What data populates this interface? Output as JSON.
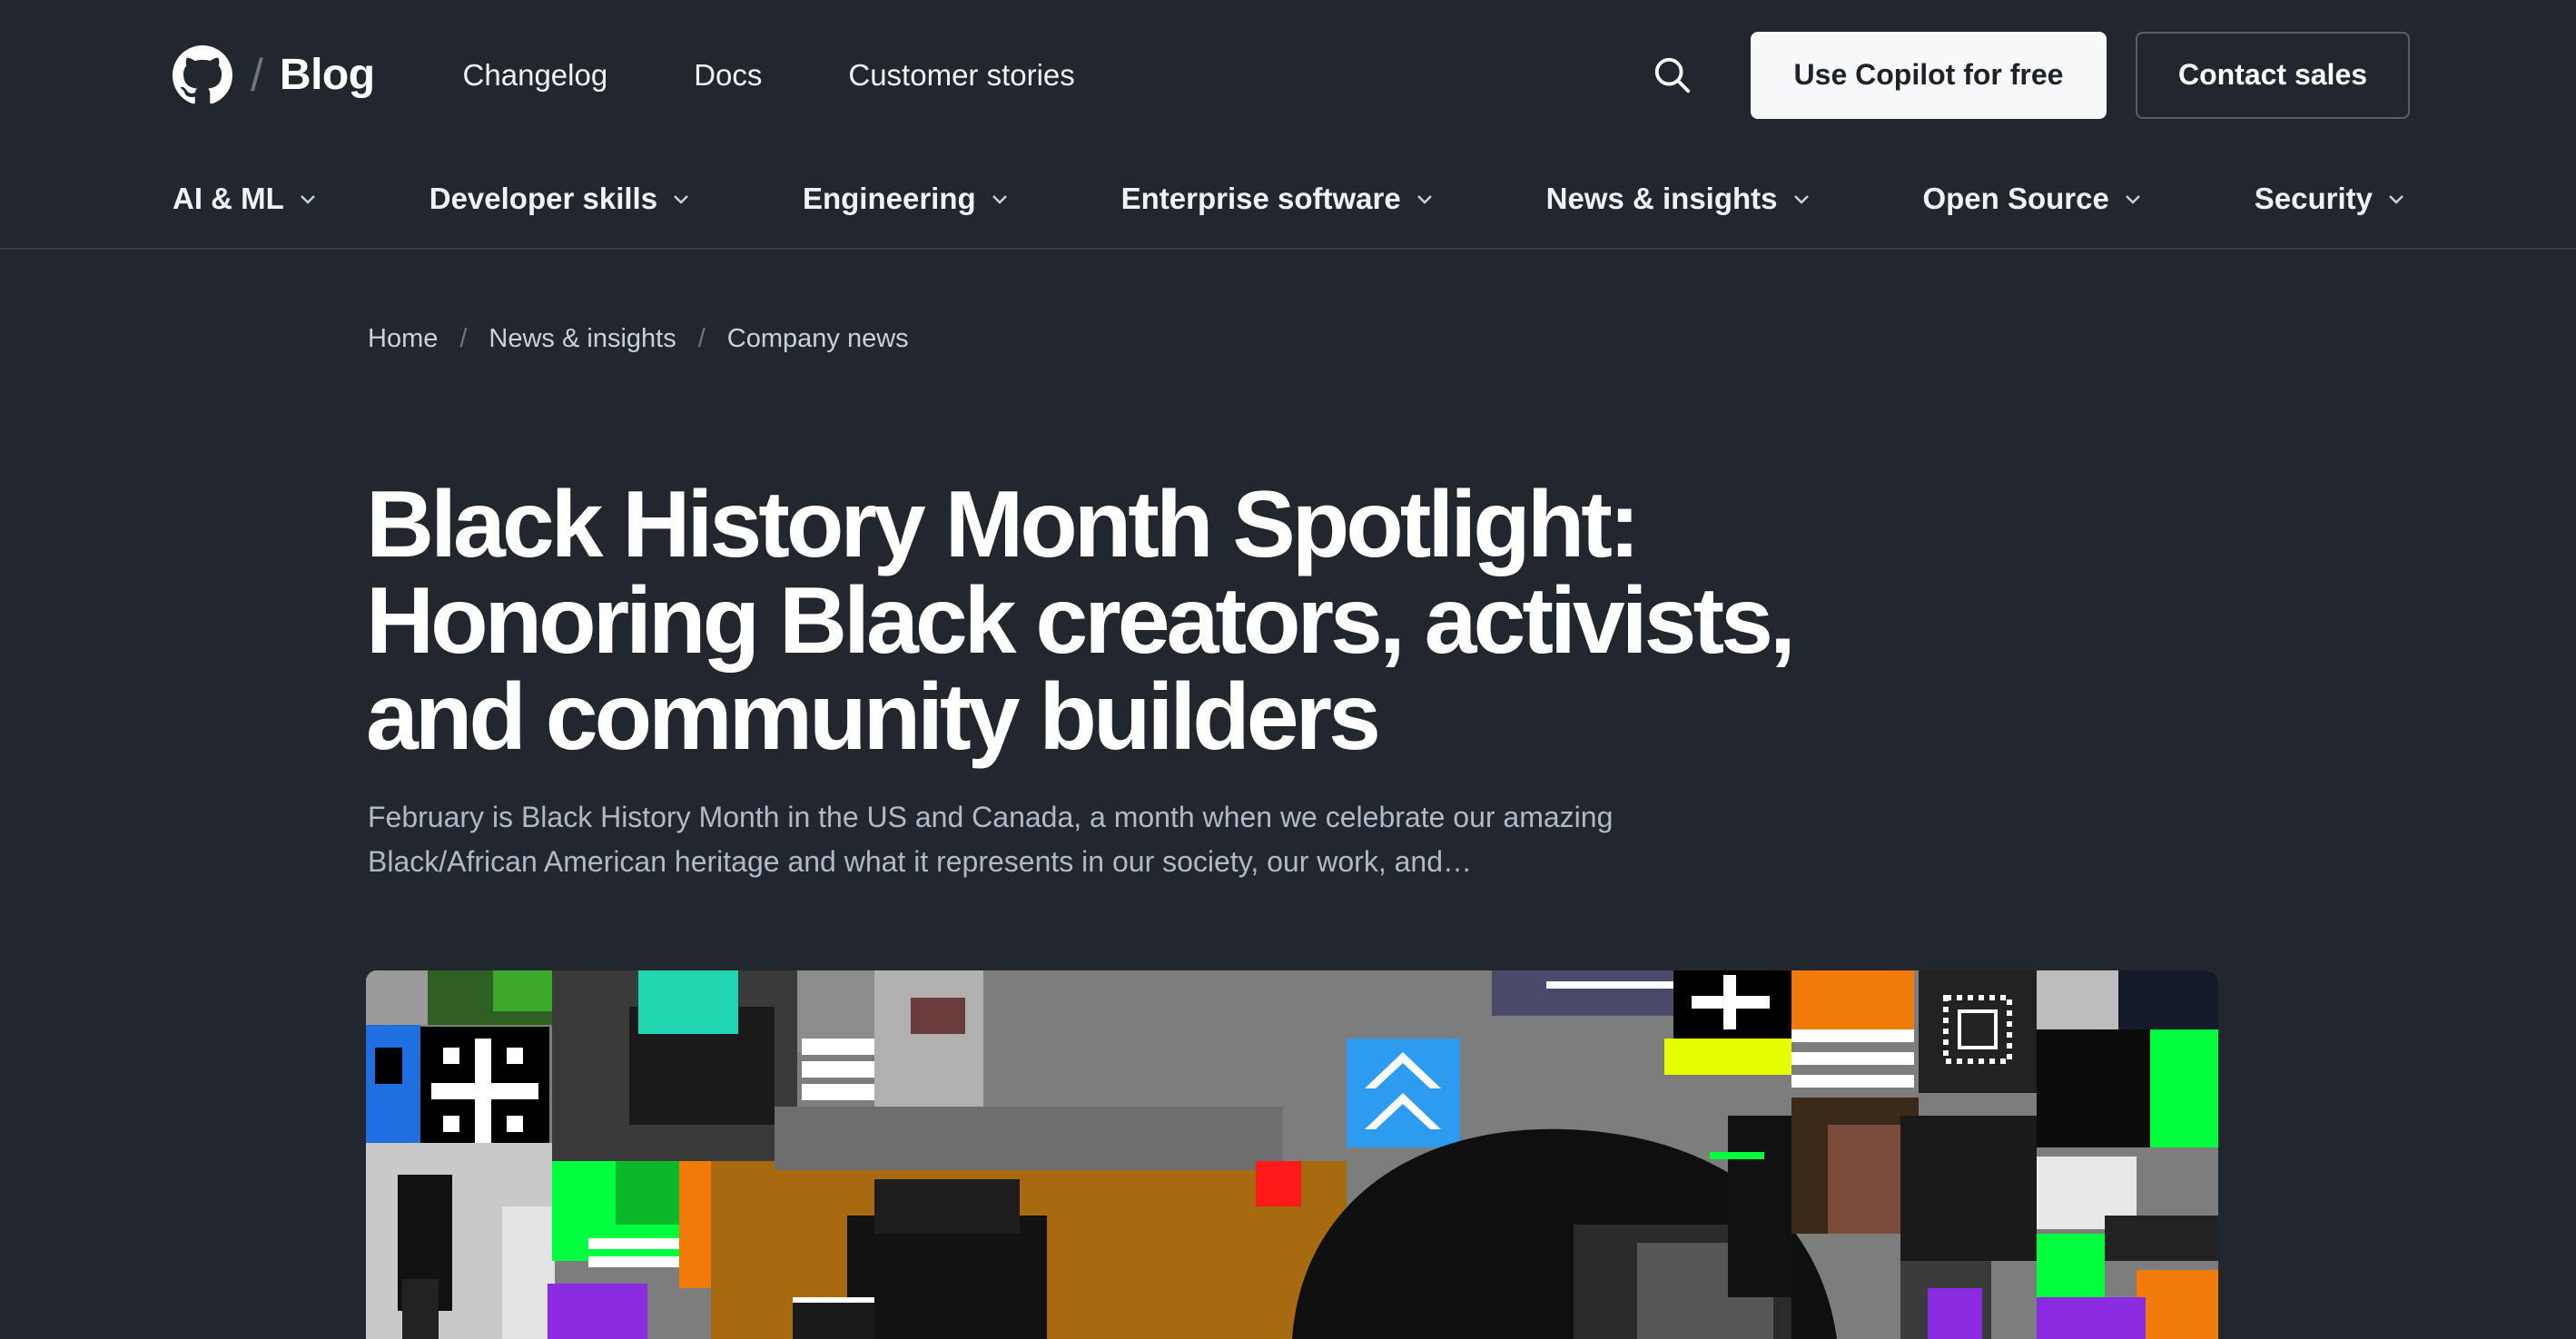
{
  "header": {
    "brand_name": "Blog",
    "brand_slash": "/",
    "logo_icon": "github-octocat-icon",
    "links": [
      {
        "label": "Changelog"
      },
      {
        "label": "Docs"
      },
      {
        "label": "Customer stories"
      }
    ],
    "search_icon": "search-icon",
    "cta_primary": "Use Copilot for free",
    "cta_secondary": "Contact sales"
  },
  "category_nav": [
    {
      "label": "AI & ML"
    },
    {
      "label": "Developer skills"
    },
    {
      "label": "Engineering"
    },
    {
      "label": "Enterprise software"
    },
    {
      "label": "News & insights"
    },
    {
      "label": "Open Source"
    },
    {
      "label": "Security"
    }
  ],
  "breadcrumb": {
    "separator": "/",
    "items": [
      {
        "label": "Home"
      },
      {
        "label": "News & insights"
      },
      {
        "label": "Company news"
      }
    ]
  },
  "article": {
    "title": "Black History Month Spotlight: Honoring Black creators, activists, and community builders",
    "excerpt": "February is Black History Month in the US and Canada, a month when we celebrate our amazing Black/African American heritage and what it represents in our society, our work, and…"
  },
  "colors": {
    "background": "#22272e",
    "accent_green": "#00ff3c",
    "accent_orange": "#f0780a",
    "accent_purple": "#8a2be2",
    "accent_blue": "#2d9cf0"
  }
}
